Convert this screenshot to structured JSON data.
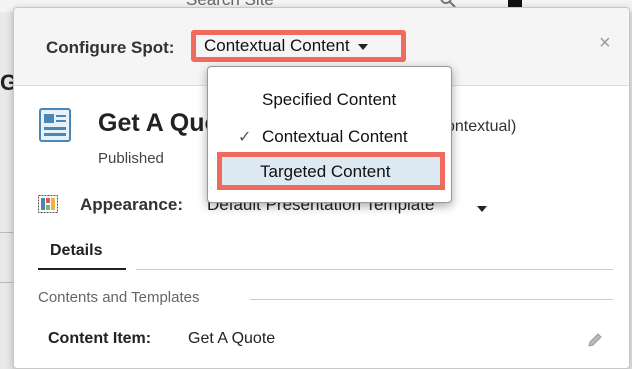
{
  "background": {
    "search_text": "Search Site",
    "left_text": "Ge"
  },
  "dialog": {
    "header_label": "Configure Spot:",
    "selected_spot": "Contextual Content",
    "close": "×",
    "title": "Get A Quo",
    "title_suffix": "ontextual)",
    "status": "Published",
    "appearance_label": "Appearance:",
    "appearance_value": "Default Presentation Template",
    "tabs": [
      {
        "label": "Details"
      }
    ],
    "section_label": "Contents and Templates",
    "content_item_label": "Content Item:",
    "content_item_value": "Get A Quote"
  },
  "dropdown": {
    "options": [
      {
        "label": "Specified Content",
        "checked": false
      },
      {
        "label": "Contextual Content",
        "checked": true
      },
      {
        "label": "Targeted Content",
        "checked": false,
        "highlighted": true
      }
    ],
    "check_glyph": "✓"
  },
  "colors": {
    "highlight_border": "#f06a5e",
    "highlight_bg": "#dde9f3"
  }
}
